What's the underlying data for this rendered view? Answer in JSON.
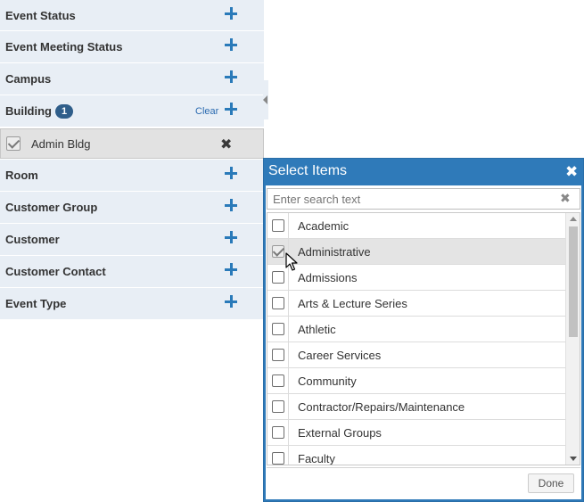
{
  "filters": {
    "event_status": "Event Status",
    "event_meeting_status": "Event Meeting Status",
    "campus": "Campus",
    "building": "Building",
    "building_count": "1",
    "building_clear": "Clear",
    "building_selected": "Admin Bldg",
    "room": "Room",
    "customer_group": "Customer Group",
    "customer": "Customer",
    "customer_contact": "Customer Contact",
    "event_type": "Event Type"
  },
  "modal": {
    "title": "Select Items",
    "close_glyph": "✖",
    "search_placeholder": "Enter search text",
    "search_clear_glyph": "✖",
    "items": [
      {
        "label": "Academic",
        "checked": false
      },
      {
        "label": "Administrative",
        "checked": true
      },
      {
        "label": "Admissions",
        "checked": false
      },
      {
        "label": "Arts & Lecture Series",
        "checked": false
      },
      {
        "label": "Athletic",
        "checked": false
      },
      {
        "label": "Career Services",
        "checked": false
      },
      {
        "label": "Community",
        "checked": false
      },
      {
        "label": "Contractor/Repairs/Maintenance",
        "checked": false
      },
      {
        "label": "External Groups",
        "checked": false
      },
      {
        "label": "Faculty",
        "checked": false
      }
    ],
    "done_label": "Done"
  },
  "icons": {
    "remove_glyph": "✖"
  },
  "colors": {
    "accent": "#2f7ab9",
    "panel_bg": "#e8eef5",
    "badge": "#2f5e8a"
  }
}
